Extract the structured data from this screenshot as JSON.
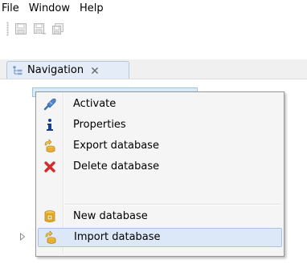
{
  "menubar": {
    "items": [
      {
        "label": "File"
      },
      {
        "label": "Window"
      },
      {
        "label": "Help"
      }
    ]
  },
  "toolbar": {
    "buttons": [
      {
        "icon": "save-icon",
        "enabled": false
      },
      {
        "icon": "save-as-icon",
        "enabled": false
      },
      {
        "icon": "save-all-icon",
        "enabled": false
      }
    ]
  },
  "view": {
    "tab": {
      "label": "Navigation",
      "icon": "navigation-tree-icon",
      "close_icon": "close-icon"
    }
  },
  "context_menu": {
    "items": [
      {
        "label": "Activate",
        "icon": "activate-plug-icon",
        "icon_color": "#4a7fc1"
      },
      {
        "label": "Properties",
        "icon": "info-icon",
        "icon_color": "#1b3f8f"
      },
      {
        "label": "Export database",
        "icon": "export-database-icon",
        "icon_color": "#d9a21b"
      },
      {
        "label": "Delete database",
        "icon": "delete-icon",
        "icon_color": "#d42a2a"
      },
      {
        "label": "New database",
        "icon": "new-database-icon",
        "icon_color": "#e0a81e"
      },
      {
        "label": "Import database",
        "icon": "import-database-icon",
        "icon_color": "#d9a21b",
        "highlighted": true
      }
    ]
  },
  "colors": {
    "highlight_background": "#dce8f8",
    "highlight_border": "#a6c2e6",
    "menu_background": "#f5f5f5",
    "tab_background": "#e4ecf7"
  }
}
